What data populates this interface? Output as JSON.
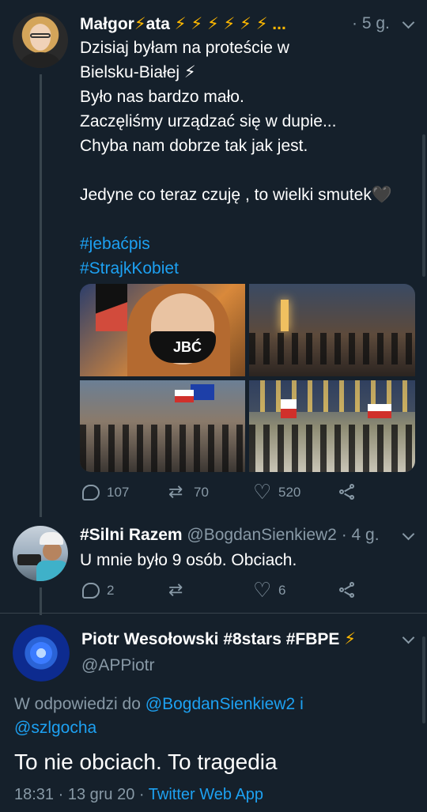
{
  "tweet1": {
    "name": "Małgor",
    "name_mid": "ata",
    "name_tail": "⚡ ⚡ ⚡ ⚡ ⚡ ⚡ ...",
    "bolt": "⚡",
    "time": "· 5 g.",
    "lines": [
      "Dzisiaj byłam na proteście w",
      "Bielsku-Białej ⚡",
      "Było nas bardzo mało.",
      "Zaczęliśmy urządzać się w dupie...",
      "Chyba nam dobrze tak jak jest.",
      "",
      "Jedyne co teraz czuję , to wielki smutek🖤"
    ],
    "hashtags": [
      "#jebaćpis",
      "#StrajkKobiet"
    ],
    "media_text": "JBĆ",
    "stats": {
      "replies": "107",
      "retweets": "70",
      "likes": "520"
    }
  },
  "tweet2": {
    "name": "#Silni Razem",
    "handle": "@BogdanSienkiew2",
    "time": "· 4 g.",
    "text": "U mnie było 9 osób. Obciach.",
    "stats": {
      "replies": "2",
      "retweets": "",
      "likes": "6"
    }
  },
  "tweet3": {
    "name": "Piotr Wesołowski #8stars #FBPE",
    "bolt": "⚡",
    "handle": "@APPiotr",
    "reply_prefix": "W odpowiedzi do",
    "reply_to_1": "@BogdanSienkiew2",
    "reply_conj": "i",
    "reply_to_2": "@szlgocha",
    "text": "To nie obciach. To tragedia",
    "time": "18:31",
    "date": "· 13 gru 20 ·",
    "source": "Twitter Web App"
  },
  "colors": {
    "background": "#15202b",
    "link": "#1da1f2",
    "muted": "#8899a6",
    "bolt": "#ffb800"
  }
}
